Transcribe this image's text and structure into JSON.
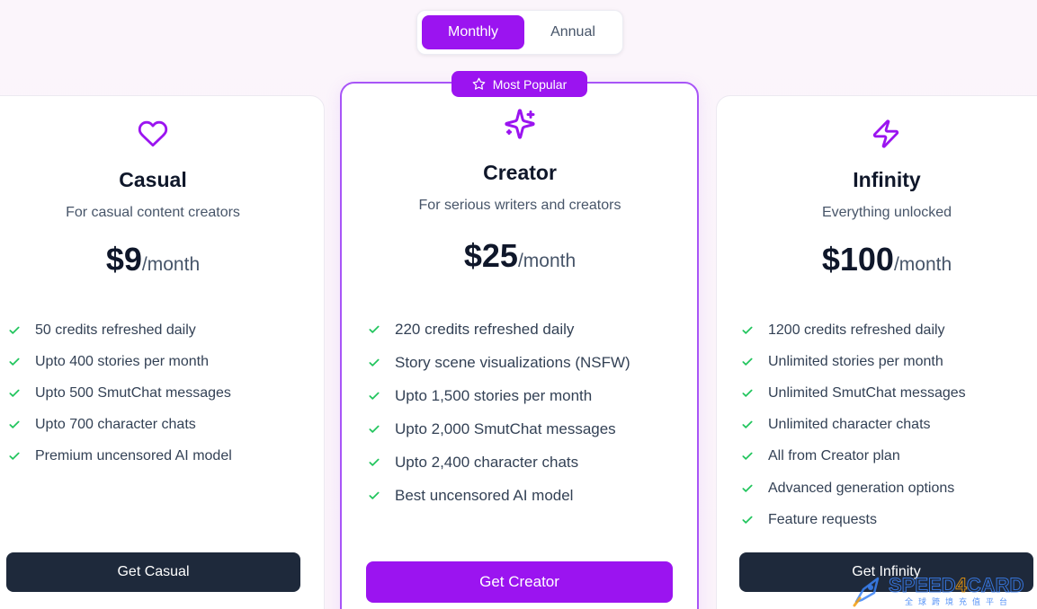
{
  "billing_toggle": {
    "monthly": "Monthly",
    "annual": "Annual",
    "selected": "Monthly"
  },
  "badge": {
    "label": "Most Popular",
    "icon": "star-icon"
  },
  "plans": [
    {
      "name": "Casual",
      "icon": "heart-icon",
      "subtitle": "For casual content creators",
      "price": "$9",
      "period": "/month",
      "features": [
        "50 credits refreshed daily",
        "Upto 400 stories per month",
        "Upto 500 SmutChat messages",
        "Upto 700 character chats",
        "Premium uncensored AI model"
      ],
      "cta": "Get Casual"
    },
    {
      "name": "Creator",
      "icon": "sparkles-icon",
      "subtitle": "For serious writers and creators",
      "price": "$25",
      "period": "/month",
      "features": [
        "220 credits refreshed daily",
        "Story scene visualizations (NSFW)",
        "Upto 1,500 stories per month",
        "Upto 2,000 SmutChat messages",
        "Upto 2,400 character chats",
        "Best uncensored AI model"
      ],
      "cta": "Get Creator"
    },
    {
      "name": "Infinity",
      "icon": "lightning-icon",
      "subtitle": "Everything unlocked",
      "price": "$100",
      "period": "/month",
      "features": [
        "1200 credits refreshed daily",
        "Unlimited stories per month",
        "Unlimited SmutChat messages",
        "Unlimited character chats",
        "All from Creator plan",
        "Advanced generation options",
        "Feature requests"
      ],
      "cta": "Get Infinity"
    }
  ],
  "watermark": {
    "brand": "SPEED4CARD",
    "tagline": "全球跨境充值平台"
  },
  "colors": {
    "accent": "#9b14f0",
    "check": "#22c55e",
    "dark_button": "#1e293b"
  }
}
